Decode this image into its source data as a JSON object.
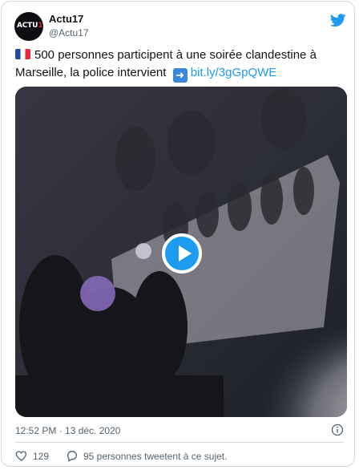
{
  "tweet": {
    "author_name": "Actu17",
    "author_handle": "@Actu17",
    "avatar_text_white": "ACTU",
    "avatar_text_red": "17",
    "flag_icon": "france-flag",
    "text_main": "500 personnes participent à une soirée clandestine à Marseille, la police intervient",
    "arrow_icon": "right-arrow-emoji",
    "link_text": "bit.ly/3gGpQWE",
    "timestamp": "12:52 PM · 13 déc. 2020",
    "like_count": "129",
    "reply_text": "95 personnes tweetent à ce sujet."
  },
  "colors": {
    "link": "#1d9bf0",
    "twitter_blue": "#1d9bf0",
    "muted": "#536471",
    "like_red": "#e0245e"
  }
}
